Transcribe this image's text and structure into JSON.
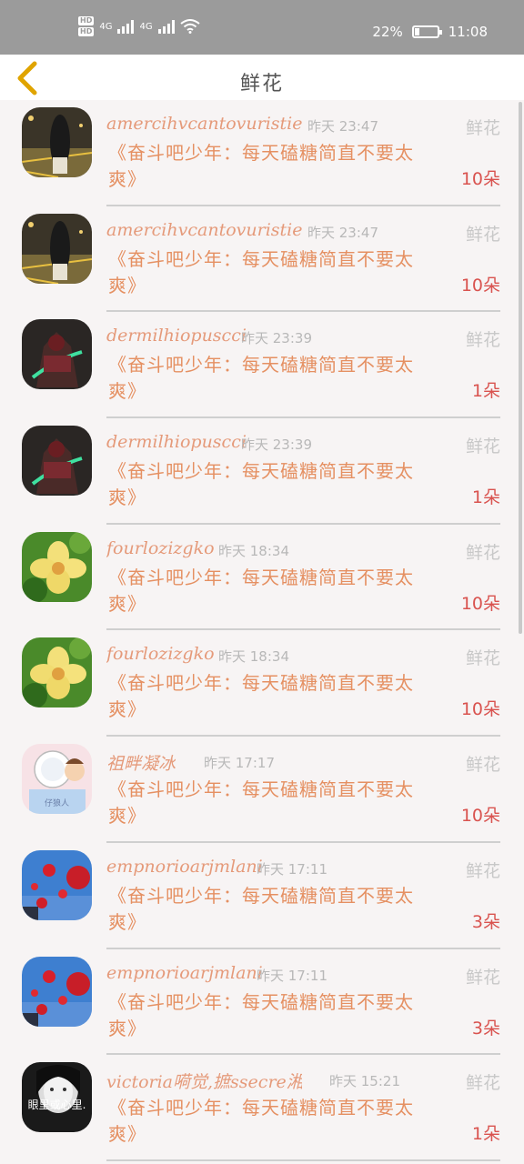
{
  "status_bar": {
    "hd1": "HD",
    "hd2": "HD",
    "net1": "4G",
    "net2": "4G",
    "battery_text": "22%",
    "battery_level": 0.22,
    "time": "11:08"
  },
  "header": {
    "title": "鲜花",
    "back_icon": "chevron-left-icon"
  },
  "rows": [
    {
      "user": "amercihvcantovuristier",
      "time": "昨天 23:47",
      "label": "鲜花",
      "msg": "《奋斗吧少年：每天磕糖简直不要太爽》",
      "count": "10朵",
      "avatar": "night-girl"
    },
    {
      "user": "amercihvcantovuristier",
      "time": "昨天 23:47",
      "label": "鲜花",
      "msg": "《奋斗吧少年：每天磕糖简直不要太爽》",
      "count": "10朵",
      "avatar": "night-girl"
    },
    {
      "user": "dermilhiopuscci",
      "time": "昨天 23:39",
      "label": "鲜花",
      "msg": "《奋斗吧少年：每天磕糖简直不要太爽》",
      "count": "1朵",
      "avatar": "warrior"
    },
    {
      "user": "dermilhiopuscci",
      "time": "昨天 23:39",
      "label": "鲜花",
      "msg": "《奋斗吧少年：每天磕糖简直不要太爽》",
      "count": "1朵",
      "avatar": "warrior"
    },
    {
      "user": "fourlozizgko",
      "time": "昨天 18:34",
      "label": "鲜花",
      "msg": "《奋斗吧少年：每天磕糖简直不要太爽》",
      "count": "10朵",
      "avatar": "flower"
    },
    {
      "user": "fourlozizgko",
      "time": "昨天 18:34",
      "label": "鲜花",
      "msg": "《奋斗吧少年：每天磕糖简直不要太爽》",
      "count": "10朵",
      "avatar": "flower"
    },
    {
      "user": "祖畔凝冰",
      "time": "昨天 17:17",
      "label": "鲜花",
      "msg": "《奋斗吧少年：每天磕糖简直不要太爽》",
      "count": "10朵",
      "avatar": "cartoon",
      "avatar_text": "仔狼人"
    },
    {
      "user": "empnorioarjmlani",
      "time": "昨天 17:11",
      "label": "鲜花",
      "msg": "《奋斗吧少年：每天磕糖简直不要太爽》",
      "count": "3朵",
      "avatar": "balloons"
    },
    {
      "user": "empnorioarjmlani",
      "time": "昨天 17:11",
      "label": "鲜花",
      "msg": "《奋斗吧少年：每天磕糖简直不要太爽》",
      "count": "3朵",
      "avatar": "balloons"
    },
    {
      "user": "victoria嗬觉,摭ssecre湘t",
      "time": "昨天 15:21",
      "label": "鲜花",
      "msg": "《奋斗吧少年：每天磕糖简直不要太爽》",
      "count": "1朵",
      "avatar": "bw-girl",
      "avatar_text": "眼里或心里."
    }
  ]
}
